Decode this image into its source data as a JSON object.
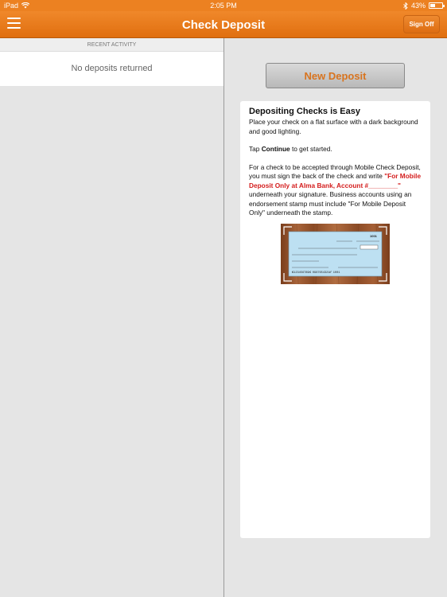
{
  "status_bar": {
    "device": "iPad",
    "time": "2:05 PM",
    "battery": "43%",
    "battery_level": 0.43
  },
  "nav": {
    "title": "Check Deposit",
    "sign_off_label": "Sign Off"
  },
  "activity": {
    "header": "RECENT ACTIVITY",
    "empty_message": "No deposits returned"
  },
  "deposit": {
    "button_label": "New Deposit"
  },
  "info": {
    "title": "Depositing Checks is Easy",
    "para1": "Place your check on a flat surface with a dark background and good lighting.",
    "tap_prefix": "Tap ",
    "tap_bold": "Continue",
    "tap_suffix": " to get started.",
    "para3_a": "For a check to be accepted through Mobile Check Deposit, you must sign the back of the check and write ",
    "para3_red": "\"For Mobile Deposit Only at Alma Bank, Account #________\"",
    "para3_b": " underneath your signature. Business accounts using an endorsement stamp must include \"For Mobile Deposit Only\" underneath the stamp."
  },
  "check_image": {
    "number": "1001",
    "micr": "⑆123456789⑆ 0987654321⑈ 1001"
  },
  "colors": {
    "accent": "#ec8121",
    "button_text": "#d8741f",
    "warning_red": "#d41d1d"
  }
}
